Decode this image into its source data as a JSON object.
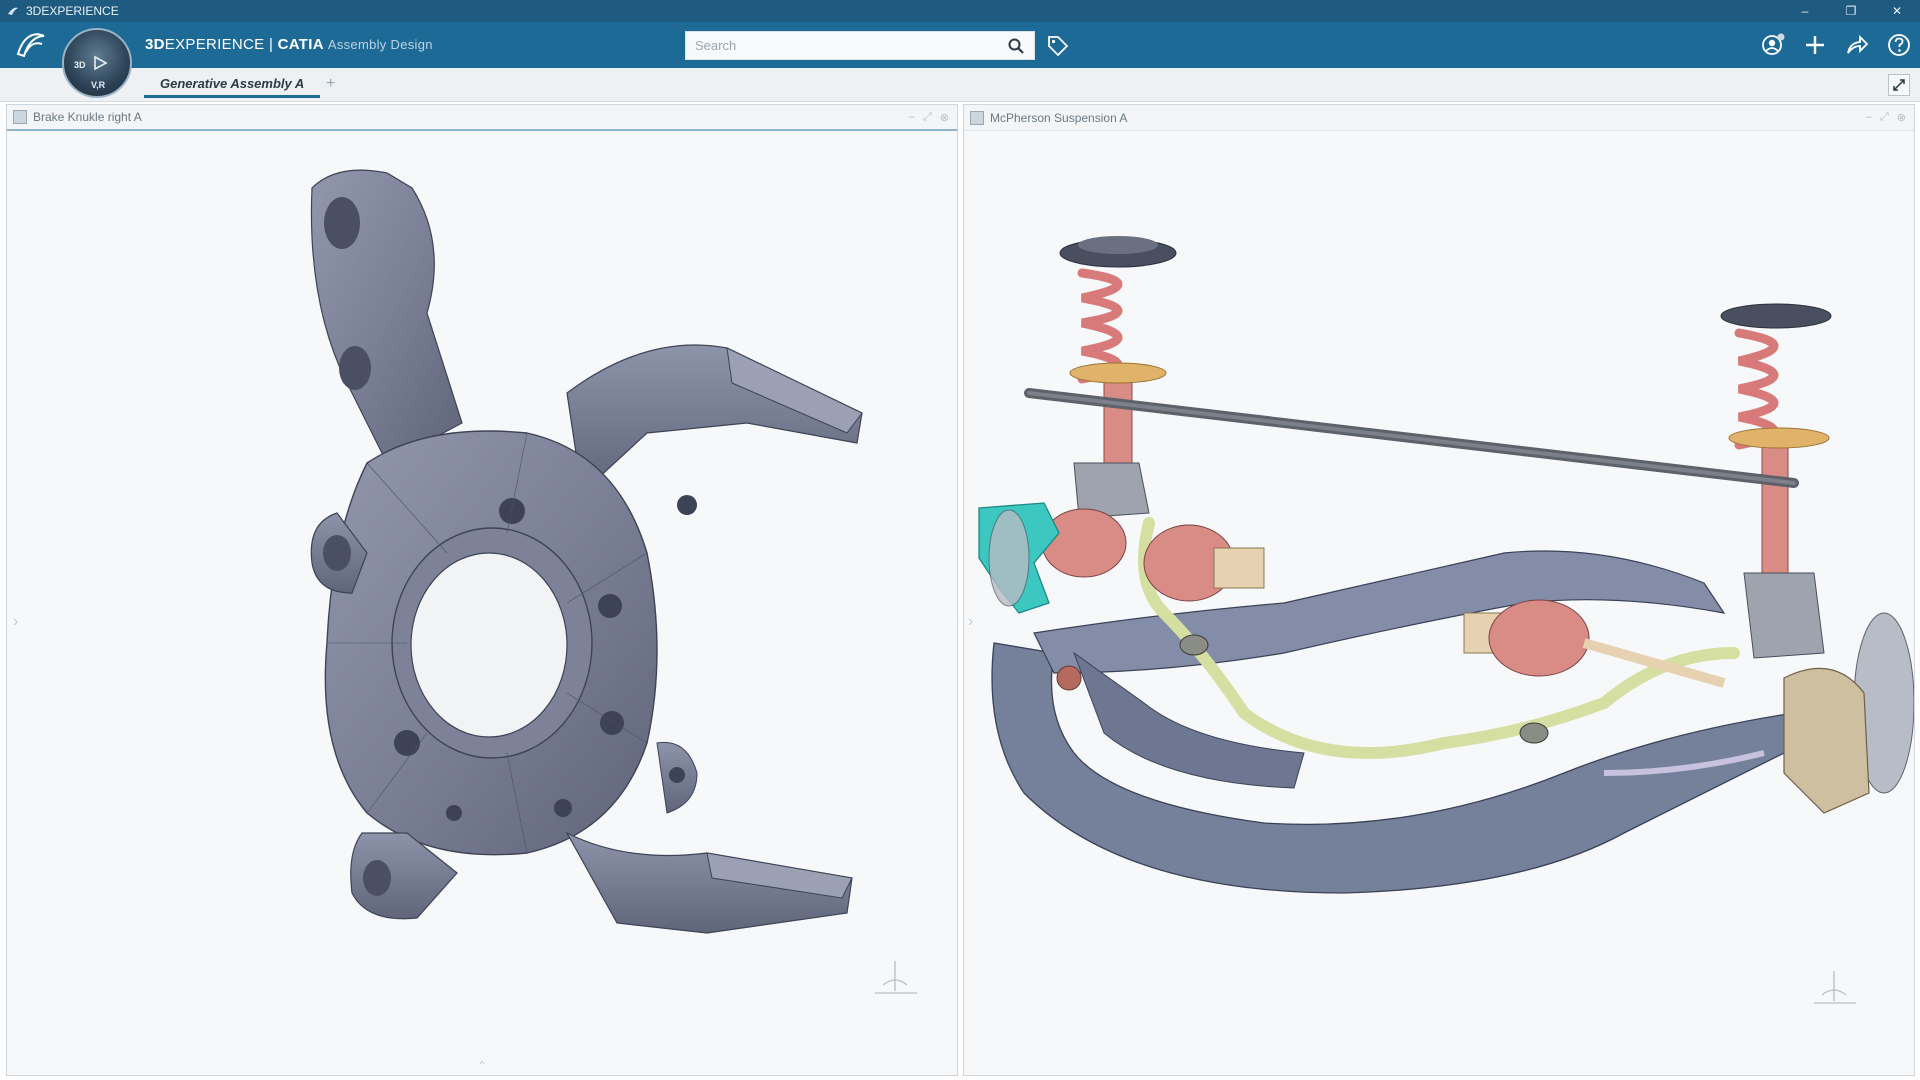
{
  "window": {
    "title": "3DEXPERIENCE",
    "controls": [
      "–",
      "❐",
      "✕"
    ]
  },
  "brand": {
    "prefix": "3D",
    "name": "EXPERIENCE",
    "separator": " | ",
    "product": "CATIA",
    "app": "Assembly Design"
  },
  "compass": {
    "label_3d": "3D",
    "label_v": "V,R"
  },
  "search": {
    "placeholder": "Search"
  },
  "tabs": [
    {
      "label": "Generative Assembly A"
    }
  ],
  "tab_add": "+",
  "panels": {
    "left": {
      "title": "Brake Knukle right A"
    },
    "right": {
      "title": "McPherson Suspension A"
    }
  },
  "colors": {
    "titlebar": "#1f5a80",
    "topbar": "#1e6a96",
    "part_steel": "#7b8096",
    "spring": "#d97a7a",
    "stabilizer": "#d6dfa2",
    "highlight": "#3cc7c0"
  }
}
